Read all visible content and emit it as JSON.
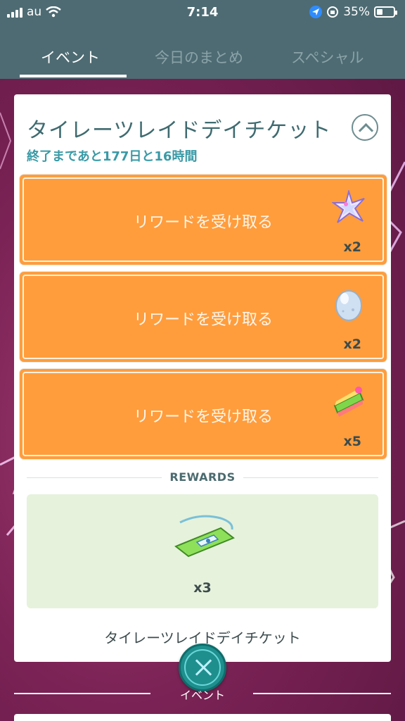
{
  "status_bar": {
    "carrier": "au",
    "time": "7:14",
    "battery": "35%",
    "battery_level": 0.35
  },
  "tabs": [
    {
      "label": "イベント",
      "active": true
    },
    {
      "label": "今日のまとめ",
      "active": false
    },
    {
      "label": "スペシャル",
      "active": false
    }
  ],
  "card": {
    "title": "タイレーツレイドデイチケット",
    "subtitle": "終了まであと177日と16時間",
    "tasks": [
      {
        "label": "リワードを受け取る",
        "count": "x2",
        "icon": "star-piece-icon"
      },
      {
        "label": "リワードを受け取る",
        "count": "x2",
        "icon": "egg-icon"
      },
      {
        "label": "リワードを受け取る",
        "count": "x5",
        "icon": "poffin-cake-icon"
      }
    ],
    "rewards_heading": "REWARDS",
    "reward": {
      "count": "x3",
      "icon": "raid-ticket-icon",
      "name": "タイレーツレイドデイチケット"
    }
  },
  "bottom": {
    "fab_label": "イベント"
  },
  "colors": {
    "header": "#4e6b73",
    "task_orange": "#ff9d3c",
    "reward_bg": "#e6f2dc",
    "accent_teal": "#1f8f8e"
  }
}
